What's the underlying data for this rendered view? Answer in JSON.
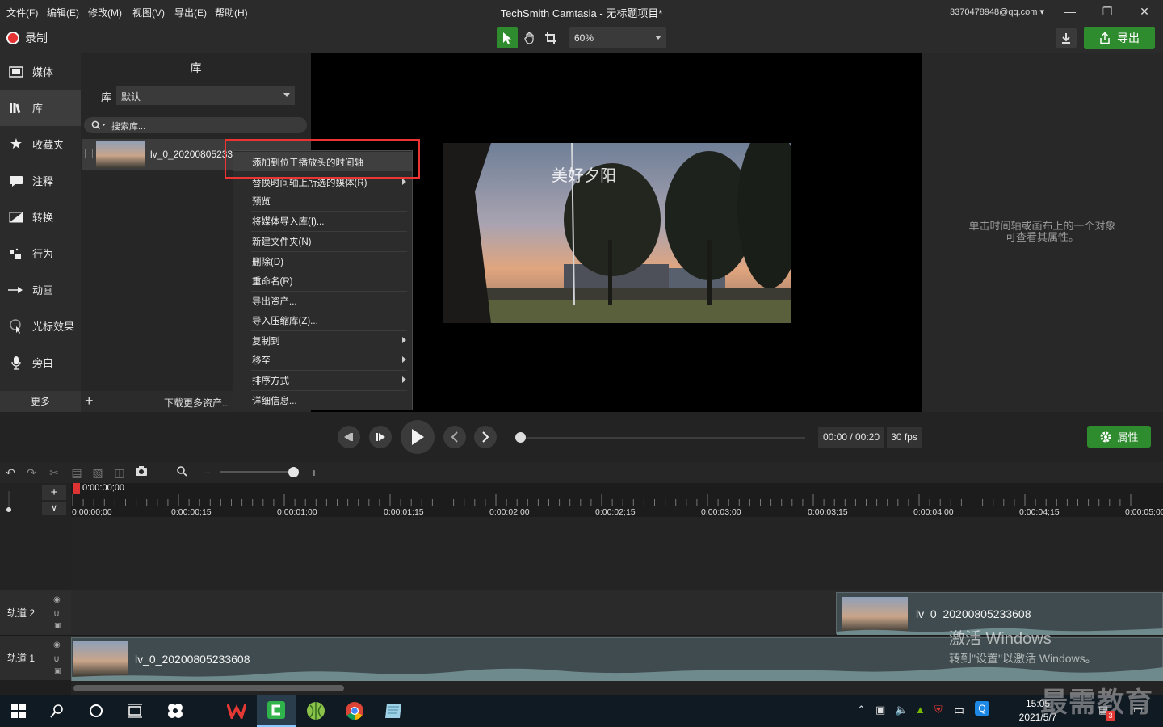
{
  "menubar": {
    "items": [
      "文件(F)",
      "编辑(E)",
      "修改(M)",
      "视图(V)",
      "导出(E)",
      "帮助(H)"
    ],
    "title": "TechSmith Camtasia - 无标题项目*",
    "account": "3370478948@qq.com ▾",
    "window_controls": [
      "minimize-icon",
      "restore-icon",
      "close-icon"
    ]
  },
  "toolbar": {
    "record_label": "录制",
    "zoom_value": "60%",
    "export_label": "导出",
    "tools": [
      "select-arrow-icon",
      "hand-pan-icon",
      "crop-icon"
    ],
    "accent": "#2e8b2e"
  },
  "sidebar": {
    "items": [
      {
        "label": "媒体",
        "icon": "film-icon"
      },
      {
        "label": "库",
        "icon": "library-icon"
      },
      {
        "label": "收藏夹",
        "icon": "star-icon"
      },
      {
        "label": "注释",
        "icon": "annotation-icon"
      },
      {
        "label": "转换",
        "icon": "transition-icon"
      },
      {
        "label": "行为",
        "icon": "behavior-icon"
      },
      {
        "label": "动画",
        "icon": "animation-icon"
      },
      {
        "label": "光标效果",
        "icon": "cursor-icon"
      },
      {
        "label": "旁白",
        "icon": "microphone-icon"
      }
    ],
    "more_label": "更多"
  },
  "library": {
    "title": "库",
    "select_label": "库",
    "select_value": "默认",
    "search_placeholder": "搜索库...",
    "item_name": "lv_0_20200805233608",
    "download_more": "下载更多资产..."
  },
  "context_menu": {
    "items": [
      {
        "label": "添加到位于播放头的时间轴",
        "submenu": false
      },
      {
        "label": "替换时间轴上所选的媒体(R)",
        "submenu": true
      },
      {
        "label": "预览",
        "submenu": false
      },
      {
        "label": "将媒体导入库(I)...",
        "submenu": false
      },
      {
        "label": "新建文件夹(N)",
        "submenu": false
      },
      {
        "label": "删除(D)",
        "submenu": false
      },
      {
        "label": "重命名(R)",
        "submenu": false
      },
      {
        "label": "导出资产...",
        "submenu": false
      },
      {
        "label": "导入压缩库(Z)...",
        "submenu": false
      },
      {
        "label": "复制到",
        "submenu": true
      },
      {
        "label": "移至",
        "submenu": true
      },
      {
        "label": "排序方式",
        "submenu": true
      },
      {
        "label": "详细信息...",
        "submenu": false
      }
    ],
    "highlight_color": "#e33333"
  },
  "canvas": {
    "caption": "美好夕阳"
  },
  "properties": {
    "hint_line1": "单击时间轴或画布上的一个对象",
    "hint_line2": "可查看其属性。",
    "button_label": "属性"
  },
  "playback": {
    "time": "00:00 / 00:20",
    "fps": "30 fps"
  },
  "timeline": {
    "playhead": "0:00:00;00",
    "ticks": [
      "0:00:00;00",
      "0:00:00;15",
      "0:00:01;00",
      "0:00:01;15",
      "0:00:02;00",
      "0:00:02;15",
      "0:00:03;00",
      "0:00:03;15",
      "0:00:04;00",
      "0:00:04;15",
      "0:00:05;00"
    ],
    "tracks": [
      {
        "name": "轨道 2",
        "clip": "lv_0_20200805233608"
      },
      {
        "name": "轨道 1",
        "clip": "lv_0_20200805233608"
      }
    ]
  },
  "overlay": {
    "activate_title": "激活 Windows",
    "activate_sub": "转到\"设置\"以激活 Windows。",
    "watermark": "最需教育"
  },
  "taskbar": {
    "time": "15:05",
    "date": "2021/5/7",
    "ime": "中",
    "notif_badge": "3"
  }
}
